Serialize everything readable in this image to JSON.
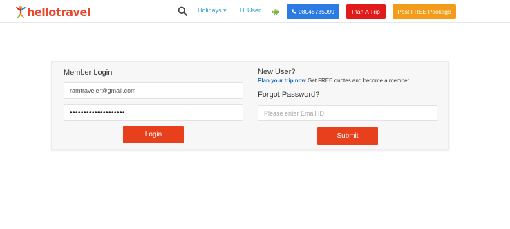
{
  "header": {
    "logo_text": "hellotravel",
    "search_icon": "search-icon",
    "holidays_label": "Holidays",
    "holidays_caret": "▾",
    "user_label": "Hi User",
    "android_icon": "android-icon",
    "phone_icon": "phone-icon",
    "phone_label": "08048735999",
    "plan_trip_label": "Plan A Trip",
    "post_package_label": "Post FREE Package"
  },
  "login": {
    "title": "Member Login",
    "email_value": "ramtraveler@gmail.com",
    "password_value": "••••••••••••••••••••",
    "login_button": "Login"
  },
  "signup": {
    "title": "New User?",
    "plan_link": "Plan your trip now",
    "plan_text": "Get FREE quotes and become a member",
    "forgot_title": "Forgot Password?",
    "email_placeholder": "Please enter Email ID",
    "submit_button": "Submit"
  },
  "colors": {
    "brand": "#e8482b",
    "link": "#2aa0cf",
    "phone_button": "#2c7be5",
    "plan_button": "#e11a1a",
    "post_button": "#f39c1a",
    "action_button": "#e8401d"
  }
}
